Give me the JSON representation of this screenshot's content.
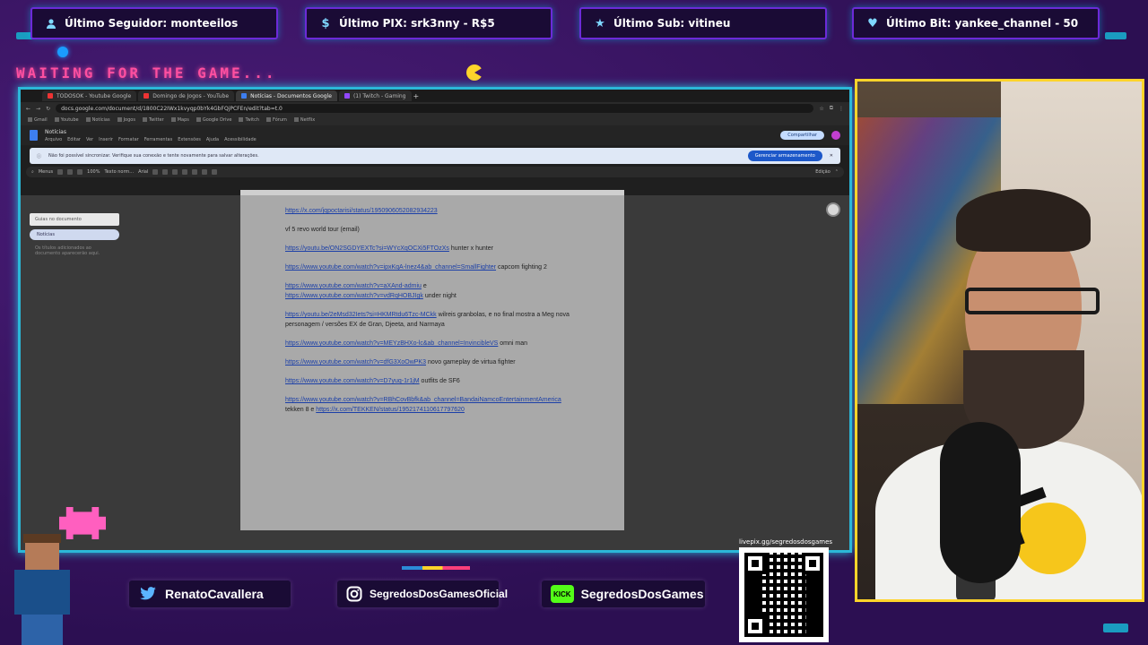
{
  "alerts": [
    {
      "icon": "person-icon",
      "label": "Último Seguidor: monteeilos"
    },
    {
      "icon": "dollar-icon",
      "label": "Último PIX: srk3nny - R$5"
    },
    {
      "icon": "star-icon",
      "label": "Último Sub: vitineu"
    },
    {
      "icon": "heart-icon",
      "label": "Último Bit: yankee_channel - 50"
    }
  ],
  "overlay": {
    "waiting_text": "WAITING FOR THE GAME..."
  },
  "browser": {
    "tabs": [
      {
        "label": "TODOSOK - Youtube Google",
        "active": false
      },
      {
        "label": "Domingo de Jogos - YouTube",
        "active": false
      },
      {
        "label": "Notícias - Documentos Google",
        "active": true
      },
      {
        "label": "(1) Twitch - Gaming",
        "active": false
      }
    ],
    "address": "docs.google.com/document/d/1800C22IWx1kvyqp0bYk4GbFQjPCFEn/edit?tab=t.0",
    "bookmarks": [
      "Gmail",
      "Youtube",
      "Notícias",
      "Jogos",
      "Twitter",
      "Maps",
      "Google Drive",
      "Twitch",
      "Fórum",
      "Netflix"
    ],
    "doc_title": "Notícias",
    "doc_menus": [
      "Arquivo",
      "Editar",
      "Ver",
      "Inserir",
      "Formatar",
      "Ferramentas",
      "Extensões",
      "Ajuda",
      "Acessibilidade"
    ],
    "share_label": "Compartilhar",
    "banner_text": "Não foi possível sincronizar. Verifique sua conexão e tente novamente para salvar alterações.",
    "banner_button": "Gerenciar armazenamento",
    "toolbar_menus": "Menus",
    "toolbar_zoom": "100%",
    "toolbar_style": "Texto norm...",
    "toolbar_font": "Arial",
    "toolbar_mode": "Edição",
    "outline_search": "Guias no documento",
    "outline_active": "Notícias",
    "outline_hint": "Os títulos adicionados ao documento aparecerão aqui."
  },
  "doc_lines": [
    {
      "link": "https://x.com/jqpoctarisi/status/1950906052082934223",
      "text": ""
    },
    {
      "link": "",
      "text": "vf 5 revo world tour (email)"
    },
    {
      "link": "https://youtu.be/ON2SGDYEXTc?si=WYcXqOCXi5FTOzXs",
      "text": " hunter x hunter"
    },
    {
      "link": "https://www.youtube.com/watch?v=ipxKqA-lnez4&ab_channel=SmallFighter",
      "text": " capcom fighting 2"
    },
    {
      "link": "https://www.youtube.com/watch?v=aXAnd-admiu",
      "text": " e"
    },
    {
      "link": "https://www.youtube.com/watch?v=vdRqHOBJIgk",
      "text": " under night"
    },
    {
      "link": "https://youtu.be/2eMsd32Iets?si=HKMRtdu6Tzc-MCkk",
      "text": " wilreis granbolas, e no final mostra a Meg nova personagem / versões EX de Gran, Djeeta, and Narmaya"
    },
    {
      "link": "https://www.youtube.com/watch?v=MEYzBHXo-lc&ab_channel=InvincibleVS",
      "text": " omni man"
    },
    {
      "link": "https://www.youtube.com/watch?v=dfG3XoOwPK3",
      "text": " novo gameplay de virtua fighter"
    },
    {
      "link": "https://www.youtube.com/watch?v=D7yuq-1r1jM",
      "text": " outfits de SF6"
    },
    {
      "link": "https://www.youtube.com/watch?v=RBhCovBbfk&ab_channel=BandaiNamcoEntertainmentAmerica",
      "text": " tekken 8 e "
    },
    {
      "link": "https://x.com/TEKKEN/status/1952174110617797620",
      "text": ""
    }
  ],
  "socials": [
    {
      "icon": "twitter-icon",
      "label": "RenatoCavallera"
    },
    {
      "icon": "instagram-icon",
      "label": "SegredosDosGamesOficial"
    },
    {
      "icon": "kick-icon",
      "icon_text": "KICK",
      "label": "SegredosDosGames"
    }
  ],
  "qr": {
    "url": "livepix.gg/segredosdosgames"
  },
  "colors": {
    "background": "#3a1464",
    "frame_accent": "#2bb8d8",
    "webcam_border": "#ffd42a",
    "waiting_text": "#ff4fa0",
    "kick_green": "#53fc18"
  }
}
